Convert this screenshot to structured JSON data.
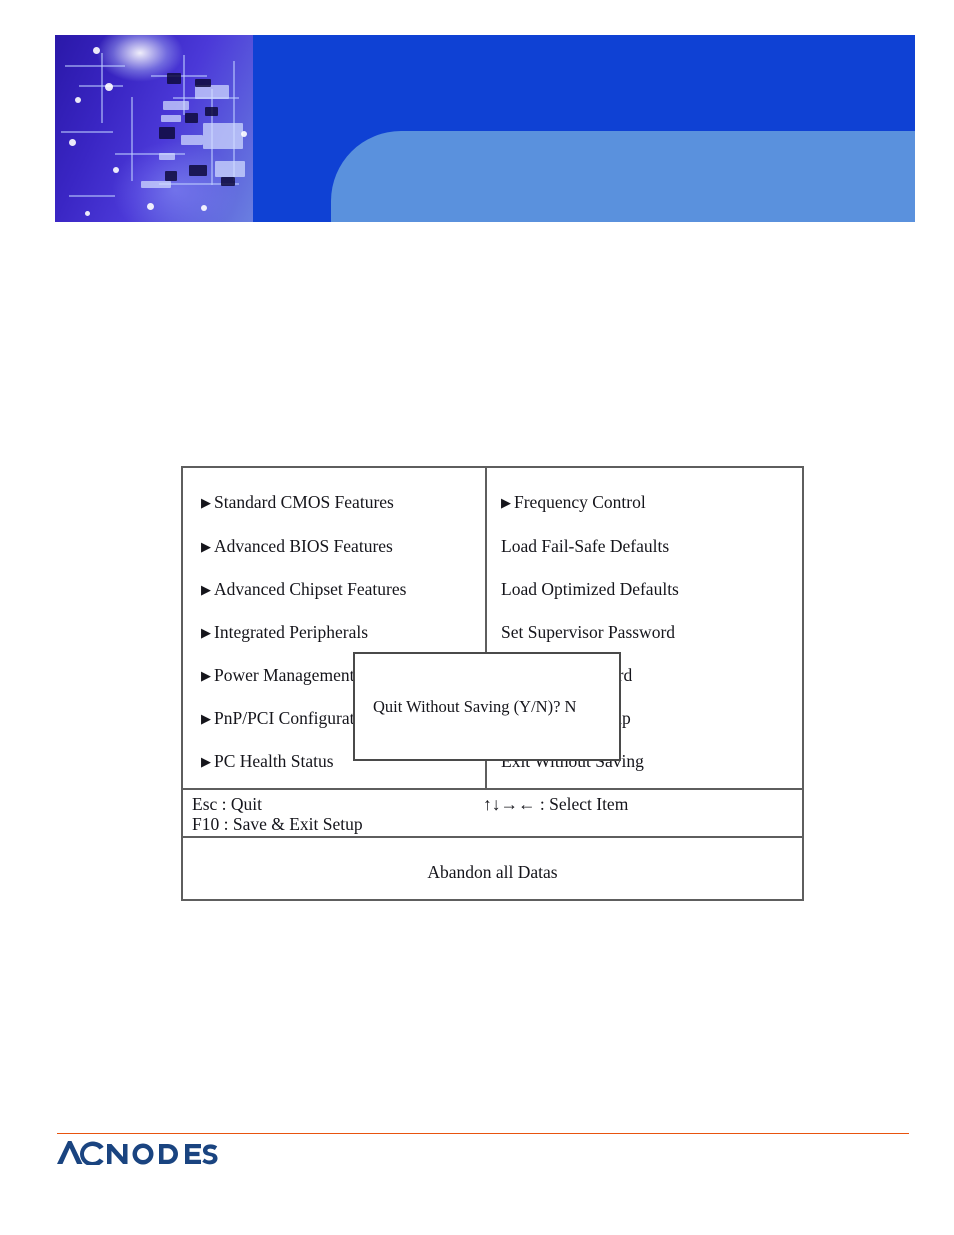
{
  "header": {
    "banner_color": "#0f41d4",
    "banner_accent_color": "#5a91dd",
    "photo_name": "circuit-board-photo"
  },
  "bios": {
    "menu_left": [
      {
        "label": "Standard CMOS Features",
        "has_arrow": true
      },
      {
        "label": "Advanced BIOS Features",
        "has_arrow": true
      },
      {
        "label": "Advanced Chipset Features",
        "has_arrow": true
      },
      {
        "label": "Integrated Peripherals",
        "has_arrow": true
      },
      {
        "label": "Power Management Setup",
        "has_arrow": true
      },
      {
        "label": "PnP/PCI Configurations",
        "has_arrow": true
      },
      {
        "label": "PC Health Status",
        "has_arrow": true
      }
    ],
    "menu_right": [
      {
        "label": "Frequency Control",
        "has_arrow": true
      },
      {
        "label": "Load Fail-Safe Defaults",
        "has_arrow": false
      },
      {
        "label": "Load Optimized Defaults",
        "has_arrow": false
      },
      {
        "label": "Set Supervisor Password",
        "has_arrow": false
      },
      {
        "label": "Set User Password",
        "has_arrow": false
      },
      {
        "label": "Save & Exit Setup",
        "has_arrow": false
      },
      {
        "label": "Exit Without Saving",
        "has_arrow": false
      }
    ],
    "arrow_glyph": "▶",
    "hints": {
      "esc": "Esc : Quit",
      "f10": "F10 : Save & Exit Setup",
      "select": "↑↓→← : Select Item"
    },
    "status_message": "Abandon all Datas"
  },
  "dialog": {
    "message": "Quit Without Saving (Y/N)? N"
  },
  "brand": {
    "name": "ACNODES",
    "logo_color": "#1a4480",
    "rule_color": "#e8530e"
  }
}
